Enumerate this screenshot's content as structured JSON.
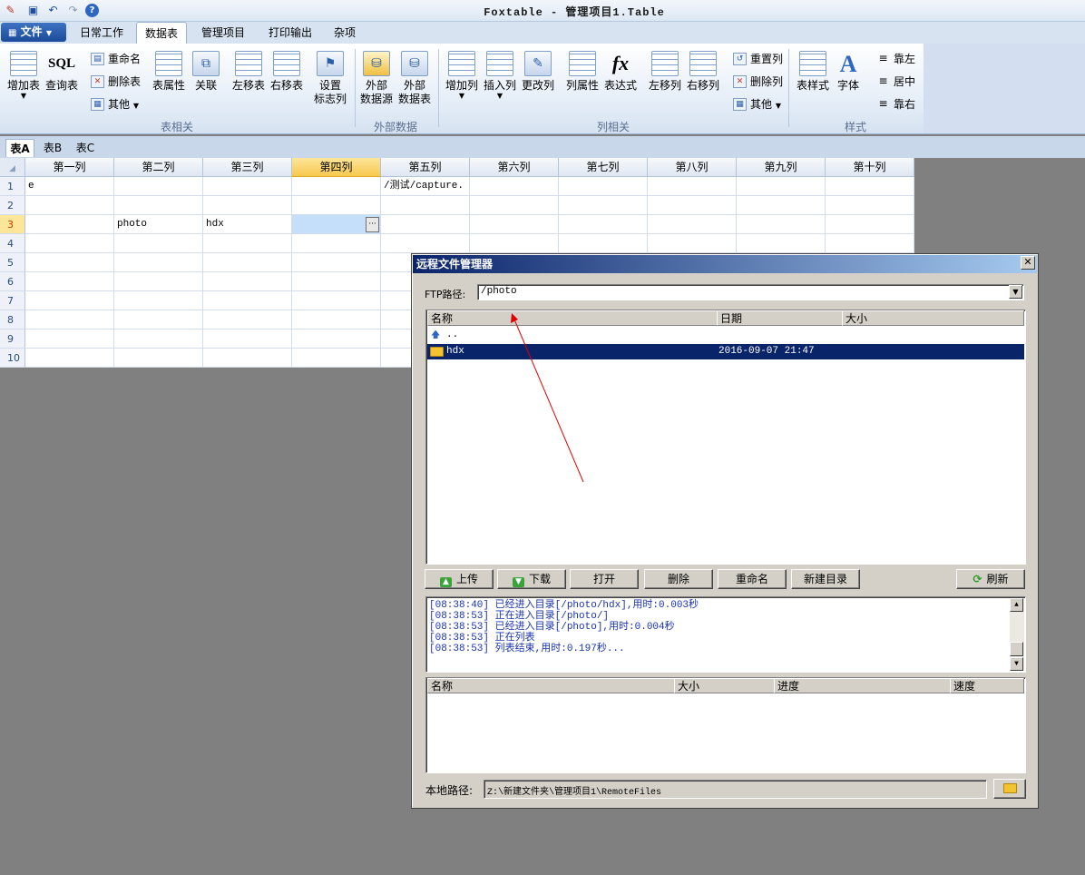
{
  "app": {
    "title": "Foxtable - 管理项目1.Table"
  },
  "ribbon_tabs": [
    "日常工作",
    "数据表",
    "管理项目",
    "打印输出",
    "杂项"
  ],
  "file_menu": "文件",
  "ribbon": {
    "add_table": "增加表",
    "query_table": "查询表",
    "sql_icon": "SQL",
    "rename": "重命名",
    "delete_table": "删除表",
    "other": "其他",
    "table_props": "表属性",
    "relation": "关联",
    "move_left": "左移表",
    "move_right": "右移表",
    "set_flag": [
      "设置",
      "标志列"
    ],
    "ext_source": [
      "外部",
      "数据源"
    ],
    "ext_table": [
      "外部",
      "数据表"
    ],
    "add_col": "增加列",
    "insert_col": "插入列",
    "modify_col": "更改列",
    "col_props": "列属性",
    "expression": "表达式",
    "fx_icon": "fx",
    "col_left": "左移列",
    "col_right": "右移列",
    "reset_col": "重置列",
    "delete_col": "删除列",
    "other2": "其他",
    "table_style": "表样式",
    "font": "字体",
    "align_left": "靠左",
    "align_center": "居中",
    "align_right": "靠右",
    "groups": {
      "table": "表相关",
      "external": "外部数据",
      "column": "列相关",
      "style": "样式"
    }
  },
  "sheet_tabs": [
    "表A",
    "表B",
    "表C"
  ],
  "grid": {
    "columns": [
      "第一列",
      "第二列",
      "第三列",
      "第四列",
      "第五列",
      "第六列",
      "第七列",
      "第八列",
      "第九列",
      "第十列"
    ],
    "rows": [
      "1",
      "2",
      "3",
      "4",
      "5",
      "6",
      "7",
      "8",
      "9",
      "10"
    ],
    "cells": {
      "r1c1": "e",
      "r1c5": "/测试/capture.",
      "r3c2": "photo",
      "r3c3": "hdx"
    },
    "editor_button": "···"
  },
  "dialog": {
    "title": "远程文件管理器",
    "ftp_label": "FTP路径:",
    "ftp_path": "/photo",
    "list_headers": [
      "名称",
      "日期",
      "大小"
    ],
    "items": [
      {
        "name": "..",
        "date": ""
      },
      {
        "name": "hdx",
        "date": "2016-09-07 21:47"
      }
    ],
    "buttons": {
      "upload": "上传",
      "download": "下载",
      "open": "打开",
      "delete": "删除",
      "rename": "重命名",
      "new_dir": "新建目录",
      "refresh": "刷新"
    },
    "log": [
      "[08:38:40] 已经进入目录[/photo/hdx],用时:0.003秒",
      "[08:38:53] 正在进入目录[/photo/]",
      "[08:38:53] 已经进入目录[/photo],用时:0.004秒",
      "[08:38:53] 正在列表",
      "[08:38:53] 列表结束,用时:0.197秒..."
    ],
    "transfer_headers": [
      "名称",
      "大小",
      "进度",
      "速度"
    ],
    "local_label": "本地路径:",
    "local_path": "Z:\\新建文件夹\\管理项目1\\RemoteFiles"
  }
}
